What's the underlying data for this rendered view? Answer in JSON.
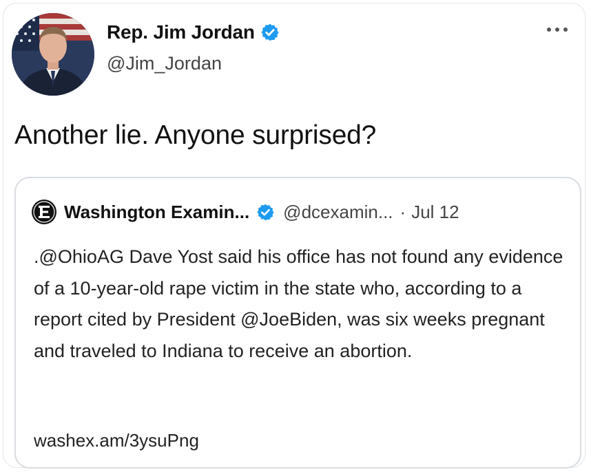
{
  "tweet": {
    "author": {
      "display_name": "Rep. Jim Jordan",
      "handle": "@Jim_Jordan",
      "verified": true
    },
    "more_icon": "ellipsis-icon",
    "text": "Another lie. Anyone surprised?",
    "quoted_tweet": {
      "author_name": "Washington Examin...",
      "handle": "@dcexamin...",
      "separator": "·",
      "date": "Jul 12",
      "verified": true,
      "logo_icon": "washington-examiner-logo-icon",
      "text": ".@OhioAG Dave Yost said his office has not found any evidence of a 10-year-old rape victim in the state who, according to a report cited by President @JoeBiden, was six weeks pregnant and traveled to Indiana to receive an abortion.",
      "link": "washex.am/3ysuPng"
    }
  },
  "colors": {
    "verified_blue": "#1d9bf0",
    "border": "#d8dce0",
    "secondary_text": "#444444"
  }
}
